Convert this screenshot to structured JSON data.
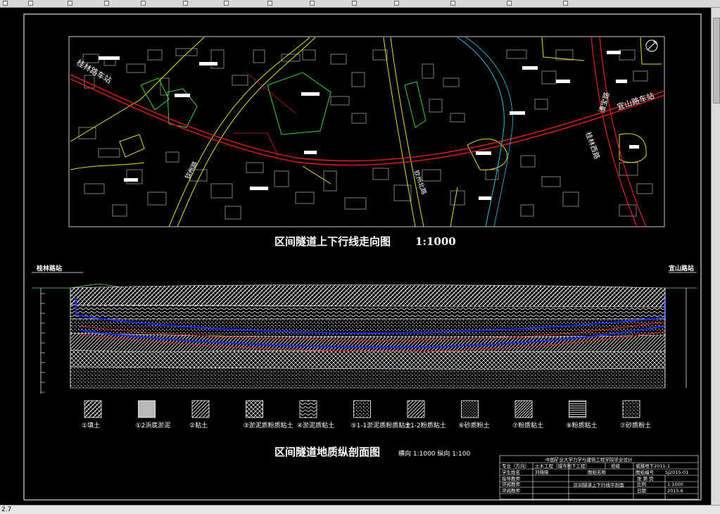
{
  "statusbar": {
    "coord": "2.7"
  },
  "map": {
    "title": "区间隧道上下行线走向图",
    "scale": "1:1000",
    "station_left": "桂林路车站",
    "station_right": "宜山路车站",
    "roads": [
      "钦州路",
      "钦州北路",
      "桂林西路",
      "漕宝路"
    ],
    "north_mark": "N"
  },
  "profile": {
    "title": "区间隧道地质纵剖面图",
    "scale": "横向 1:1000 纵向 1:100",
    "station_left": "桂林路站",
    "station_right": "宜山路站"
  },
  "legend": [
    {
      "label": "①填土",
      "pattern": "fill"
    },
    {
      "label": "①2浜底淤泥",
      "pattern": "gray"
    },
    {
      "label": "②粘土",
      "pattern": "hatch"
    },
    {
      "label": "③淤泥质粉质粘土",
      "pattern": "cross"
    },
    {
      "label": "④淤泥质粘土",
      "pattern": "wave"
    },
    {
      "label": "⑤1-1淤泥质粉质粘土",
      "pattern": "dots"
    },
    {
      "label": "⑤1-2粉质粘土",
      "pattern": "hatch"
    },
    {
      "label": "⑥砂质粉土",
      "pattern": "dots2"
    },
    {
      "label": "⑦粉质粘土",
      "pattern": "hatch2"
    },
    {
      "label": "⑧粉质粘土",
      "pattern": "lines"
    },
    {
      "label": "⑦砂质粉土",
      "pattern": "dots3"
    }
  ],
  "titleblock": {
    "school": "中国矿业大学力学与建筑工程学院毕业设计",
    "col_major": "专业（方向）",
    "major": "土木工程（城市地下工程）",
    "col_class": "班级",
    "class": "城隧地下2011-1",
    "col_no": "图纸编号",
    "no": "SJ2015-01",
    "student_label": "学生姓名",
    "student": "刘晓晓",
    "drawing_name_label": "图纸名称",
    "drawing_name": "区间隧道上下行线平剖面",
    "sheet_label": "张 第 页",
    "tutor_label": "指导教师",
    "reviewer_label": "评阅教师",
    "defense_label": "评阅教师",
    "scale_label": "比例",
    "scale": "1:1000",
    "date_label": "日期",
    "date": "2015.6"
  }
}
